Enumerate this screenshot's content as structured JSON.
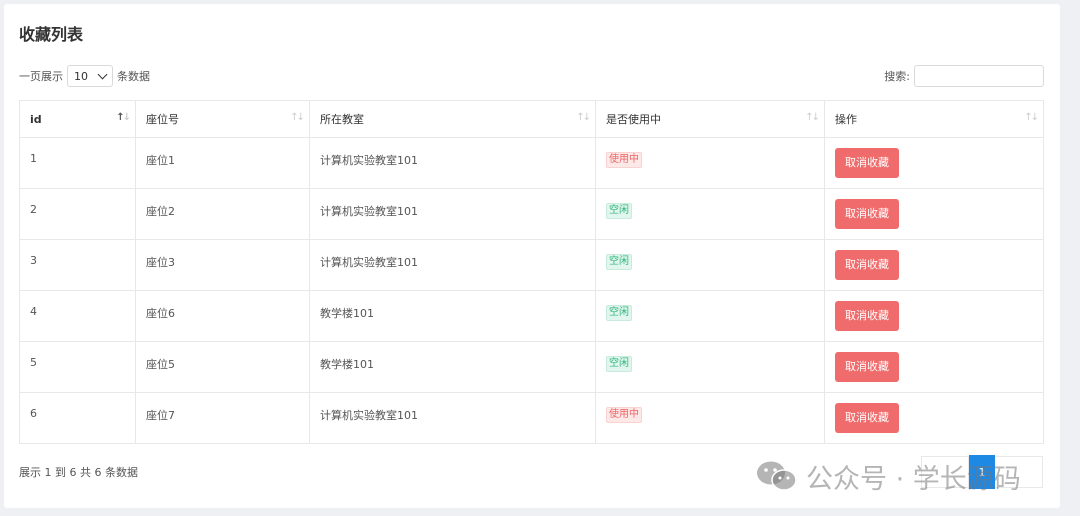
{
  "page": {
    "title": "收藏列表"
  },
  "length": {
    "prefix": "一页展示",
    "value": "10",
    "suffix": "条数据"
  },
  "search": {
    "label": "搜索:",
    "value": ""
  },
  "table": {
    "headers": [
      "id",
      "座位号",
      "所在教室",
      "是否使用中",
      "操作"
    ],
    "rows": [
      {
        "id": "1",
        "seat": "座位1",
        "room": "计算机实验教室101",
        "status": "使用中",
        "status_type": "busy",
        "action": "取消收藏"
      },
      {
        "id": "2",
        "seat": "座位2",
        "room": "计算机实验教室101",
        "status": "空闲",
        "status_type": "free",
        "action": "取消收藏"
      },
      {
        "id": "3",
        "seat": "座位3",
        "room": "计算机实验教室101",
        "status": "空闲",
        "status_type": "free",
        "action": "取消收藏"
      },
      {
        "id": "4",
        "seat": "座位6",
        "room": "教学楼101",
        "status": "空闲",
        "status_type": "free",
        "action": "取消收藏"
      },
      {
        "id": "5",
        "seat": "座位5",
        "room": "教学楼101",
        "status": "空闲",
        "status_type": "free",
        "action": "取消收藏"
      },
      {
        "id": "6",
        "seat": "座位7",
        "room": "计算机实验教室101",
        "status": "使用中",
        "status_type": "busy",
        "action": "取消收藏"
      }
    ]
  },
  "info": {
    "text": "展示 1 到 6 共 6 条数据"
  },
  "pagination": {
    "current": "1"
  },
  "watermark": {
    "text": "公众号 · 学长源码"
  },
  "colors": {
    "accent": "#1e88e5",
    "danger": "#f06b6b",
    "success": "#2fb57b"
  },
  "icons": {
    "sort": "sort-arrows-icon",
    "dropdown": "chevron-down-icon",
    "watermark": "wechat-icon"
  }
}
